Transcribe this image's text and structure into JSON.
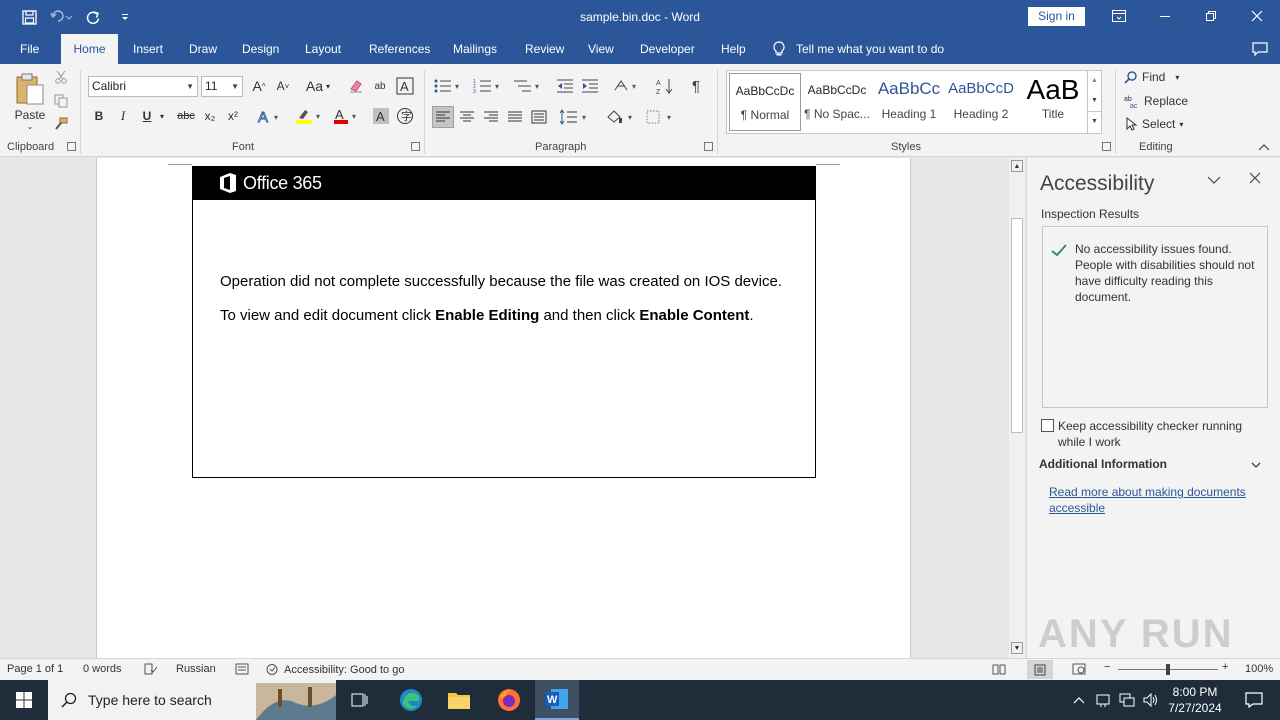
{
  "window": {
    "title": "sample.bin.doc  -  Word",
    "sign_in": "Sign in"
  },
  "qat": {
    "icons": [
      "save-icon",
      "undo-icon",
      "redo-icon",
      "customize-icon"
    ]
  },
  "tabs": [
    "File",
    "Home",
    "Insert",
    "Draw",
    "Design",
    "Layout",
    "References",
    "Mailings",
    "Review",
    "View",
    "Developer",
    "Help"
  ],
  "active_tab": "Home",
  "tell_me": "Tell me what you want to do",
  "ribbon": {
    "clipboard": {
      "label": "Clipboard",
      "paste": "Paste"
    },
    "font": {
      "label": "Font",
      "name": "Calibri",
      "size": "11",
      "grow": "A",
      "shrink": "A",
      "case": "Aa",
      "bold": "B",
      "italic": "I",
      "underline": "U",
      "strike": "abc",
      "sub": "x₂",
      "sup": "x²"
    },
    "paragraph": {
      "label": "Paragraph",
      "pilcrow": "¶"
    },
    "styles": {
      "label": "Styles",
      "items": [
        {
          "preview": "AaBbCcDc",
          "name": "¶ Normal"
        },
        {
          "preview": "AaBbCcDc",
          "name": "¶ No Spac..."
        },
        {
          "preview": "AaBbCc",
          "name": "Heading 1"
        },
        {
          "preview": "AaBbCcD",
          "name": "Heading 2"
        },
        {
          "preview": "AaB",
          "name": "Title"
        }
      ]
    },
    "editing": {
      "label": "Editing",
      "find": "Find",
      "replace": "Replace",
      "select": "Select"
    }
  },
  "document": {
    "brand": "Office 365",
    "line1": "Operation did not complete successfully because the file was created on IOS device.",
    "line2_a": "To view and edit document click ",
    "line2_b": "Enable Editing",
    "line2_c": " and then click ",
    "line2_d": "Enable Content",
    "line2_e": "."
  },
  "pane": {
    "title": "Accessibility",
    "subtitle": "Inspection Results",
    "result": "No accessibility issues found. People with disabilities should not have difficulty reading this document.",
    "keep_running": "Keep accessibility checker running while I work",
    "keep_running_checked": false,
    "additional": "Additional Information",
    "read_more": "Read more about making documents accessible"
  },
  "status": {
    "page": "Page 1 of 1",
    "words": "0 words",
    "language": "Russian",
    "accessibility": "Accessibility: Good to go",
    "zoom": "100%"
  },
  "taskbar": {
    "search_placeholder": "Type here to search",
    "time": "8:00 PM",
    "date": "7/27/2024"
  },
  "watermark": "ANY RUN"
}
